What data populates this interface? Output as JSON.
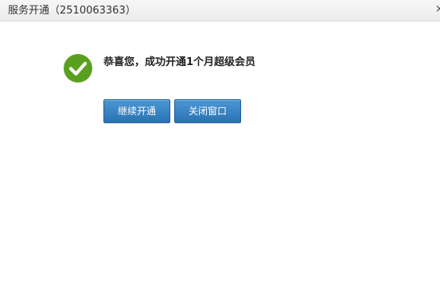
{
  "window": {
    "title": "服务开通（2510063363）",
    "close_glyph": "×"
  },
  "message": {
    "icon": "check-circle-icon",
    "icon_color": "#5aa01f",
    "text": "恭喜您，成功开通1个月超级会员"
  },
  "buttons": {
    "continue_label": "继续开通",
    "close_label": "关闭窗口",
    "color": "#2e78b8"
  }
}
